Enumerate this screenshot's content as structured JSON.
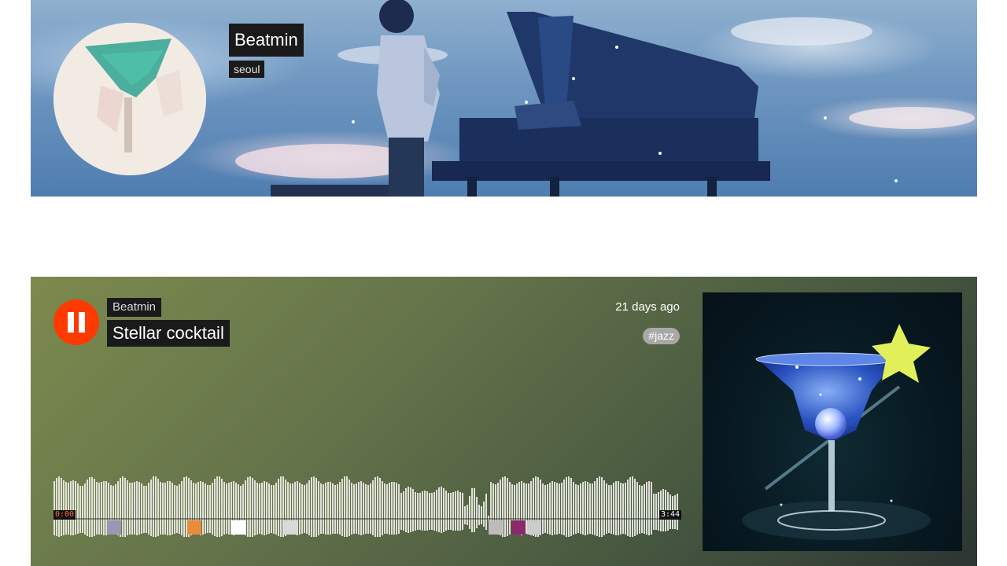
{
  "profile": {
    "name": "Beatmin",
    "city": "seoul"
  },
  "track": {
    "user": "Beatmin",
    "title": "Stellar cocktail",
    "posted": "21 days ago",
    "tag": "jazz",
    "current_time": "0:00",
    "duration": "3:44",
    "state": "playing"
  },
  "colors": {
    "play_button": "#ff3a00",
    "waveform": "#ecece6"
  },
  "icons": {
    "play_state_icon": "pause-icon",
    "tag_prefix": "#"
  }
}
